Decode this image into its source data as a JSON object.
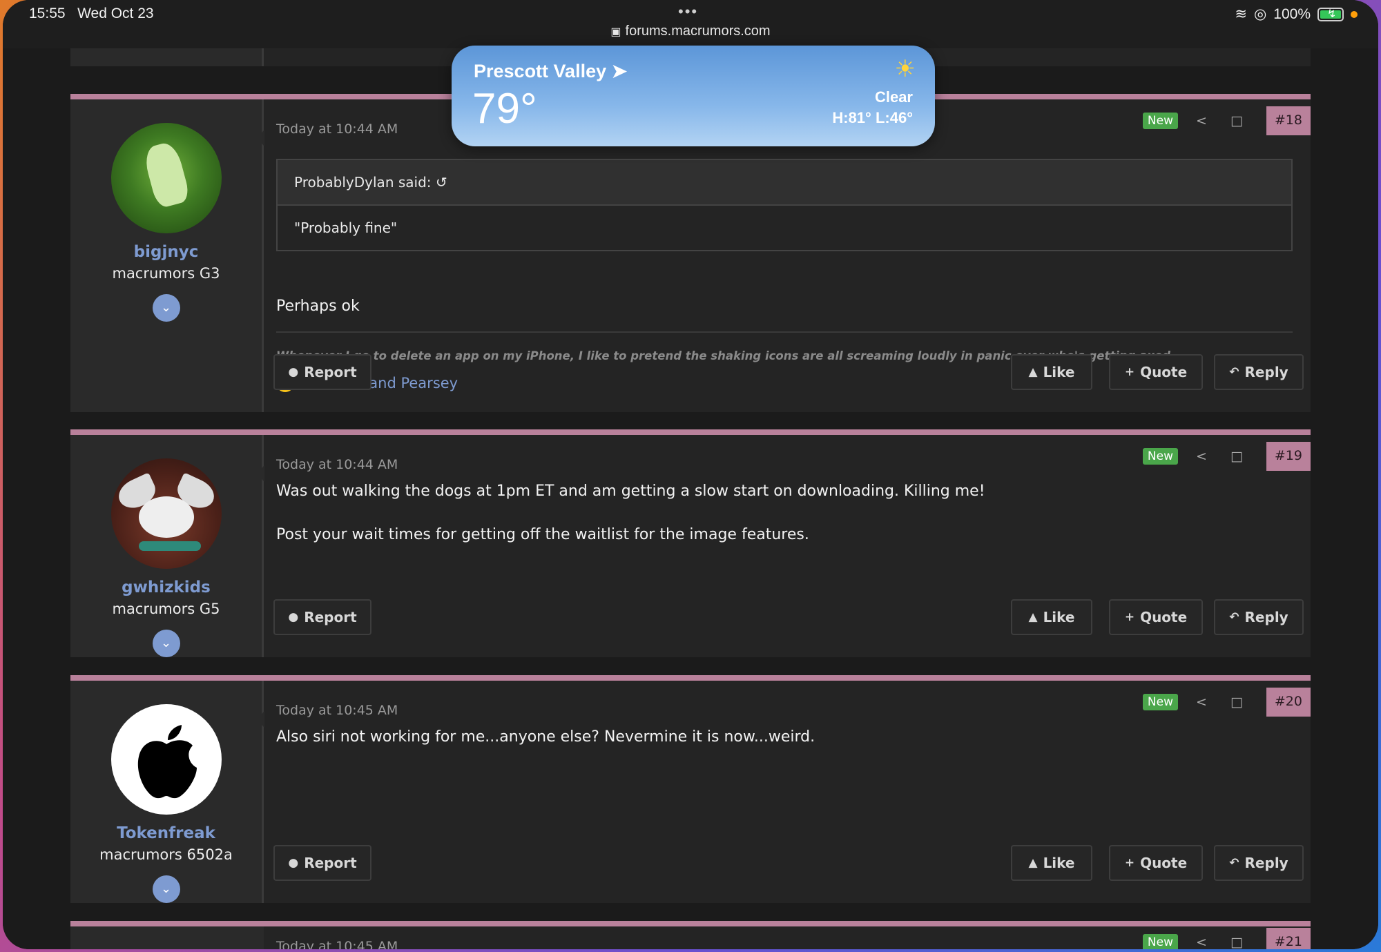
{
  "status_bar": {
    "time": "15:55",
    "date": "Wed Oct 23",
    "battery": "100%",
    "url": "forums.macrumors.com"
  },
  "weather": {
    "city": "Prescott Valley",
    "temp": "79°",
    "condition": "Clear",
    "hilo": "H:81° L:46°"
  },
  "common": {
    "new_badge": "New",
    "report": "Report",
    "like": "Like",
    "quote": "Quote",
    "reply": "Reply"
  },
  "posts": [
    {
      "number": "#18",
      "username": "bigjnyc",
      "usertitle": "macrumors G3",
      "timestamp": "Today at 10:44 AM",
      "quote_author": "ProbablyDylan said:",
      "quote_text": "\"Probably fine\"",
      "body": "Perhaps ok",
      "signature": "Whenever I go to delete an app on my iPhone, I like to pretend the shaking icons are all screaming loudly in panic over who's getting axed",
      "reactions": "winxmac and Pearsey"
    },
    {
      "number": "#19",
      "username": "gwhizkids",
      "usertitle": "macrumors G5",
      "timestamp": "Today at 10:44 AM",
      "body_1": "Was out walking the dogs at 1pm ET and am getting a slow start on downloading. Killing me!",
      "body_2": "Post your wait times for getting off the waitlist for the image features."
    },
    {
      "number": "#20",
      "username": "Tokenfreak",
      "usertitle": "macrumors 6502a",
      "timestamp": "Today at 10:45 AM",
      "body": "Also siri not working for me...anyone else? Nevermine it is now...weird."
    },
    {
      "number": "#21",
      "timestamp": "Today at 10:45 AM"
    }
  ],
  "colors": {
    "accent_bar": "#b9819b",
    "username": "#7e9bd1",
    "new_badge": "#4aa64a"
  }
}
